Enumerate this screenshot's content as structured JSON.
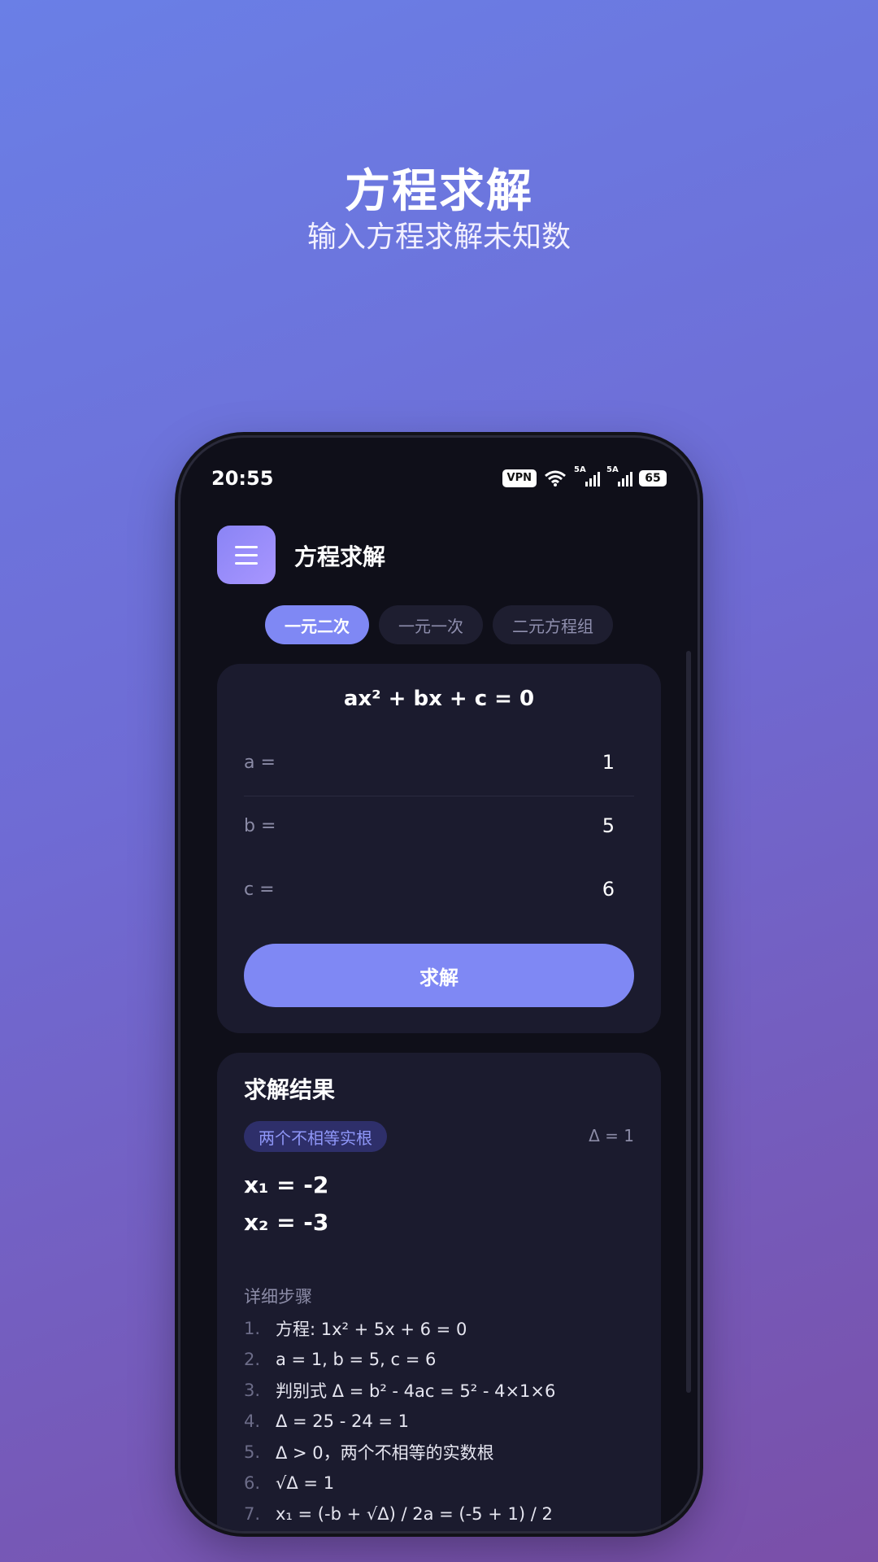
{
  "hero": {
    "title": "方程求解",
    "subtitle": "输入方程求解未知数"
  },
  "status_bar": {
    "time": "20:55",
    "vpn": "VPN",
    "signal1_label": "5A",
    "signal2_label": "5A",
    "battery": "65"
  },
  "header": {
    "title": "方程求解",
    "menu_icon": "menu-icon"
  },
  "tabs": [
    {
      "label": "一元二次",
      "active": true
    },
    {
      "label": "一元一次",
      "active": false
    },
    {
      "label": "二元方程组",
      "active": false
    }
  ],
  "input_card": {
    "equation": "ax² + bx + c = 0",
    "coefficients": [
      {
        "label": "a =",
        "value": "1"
      },
      {
        "label": "b =",
        "value": "5"
      },
      {
        "label": "c =",
        "value": "6"
      }
    ],
    "solve_label": "求解"
  },
  "result_card": {
    "title": "求解结果",
    "badge": "两个不相等实根",
    "delta": "Δ = 1",
    "roots": [
      "x₁ = -2",
      "x₂ = -3"
    ],
    "steps_title": "详细步骤",
    "steps": [
      {
        "num": "1.",
        "text": "方程: 1x² + 5x + 6 = 0"
      },
      {
        "num": "2.",
        "text": "a = 1, b = 5, c = 6"
      },
      {
        "num": "3.",
        "text": "判别式 Δ = b² - 4ac = 5² - 4×1×6"
      },
      {
        "num": "4.",
        "text": "Δ = 25 - 24 = 1"
      },
      {
        "num": "5.",
        "text": "Δ > 0，两个不相等的实数根"
      },
      {
        "num": "6.",
        "text": "√Δ = 1"
      },
      {
        "num": "7.",
        "text": "x₁ = (-b + √Δ) / 2a = (-5 + 1) / 2"
      }
    ]
  },
  "colors": {
    "accent": "#7f88f4",
    "card": "#1b1b2e",
    "screen": "#0f0f19"
  }
}
